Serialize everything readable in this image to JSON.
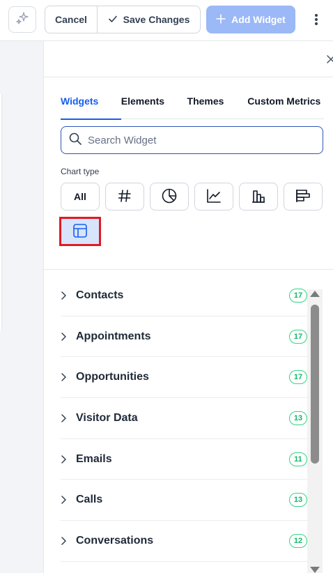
{
  "toolbar": {
    "ai_icon": "sparkle-icon",
    "cancel_label": "Cancel",
    "save_label": "Save Changes",
    "add_label": "Add Widget",
    "add_color": "#9bb8f7"
  },
  "panel": {
    "tabs": [
      {
        "label": "Widgets",
        "active": true
      },
      {
        "label": "Elements",
        "active": false
      },
      {
        "label": "Themes",
        "active": false
      },
      {
        "label": "Custom Metrics",
        "active": false
      }
    ],
    "search_placeholder": "Search Widget",
    "chart_type_label": "Chart type",
    "chart_types": [
      {
        "label": "All",
        "icon": ""
      },
      {
        "label": "",
        "icon": "hash-icon"
      },
      {
        "label": "",
        "icon": "pie-chart-icon"
      },
      {
        "label": "",
        "icon": "line-chart-icon"
      },
      {
        "label": "",
        "icon": "bar-chart-icon"
      },
      {
        "label": "",
        "icon": "horizontal-bar-chart-icon"
      },
      {
        "label": "",
        "icon": "table-icon",
        "selected": true
      }
    ],
    "categories": [
      {
        "label": "Contacts",
        "count": "17"
      },
      {
        "label": "Appointments",
        "count": "17"
      },
      {
        "label": "Opportunities",
        "count": "17"
      },
      {
        "label": "Visitor Data",
        "count": "13"
      },
      {
        "label": "Emails",
        "count": "11"
      },
      {
        "label": "Calls",
        "count": "13"
      },
      {
        "label": "Conversations",
        "count": "12"
      }
    ],
    "accent_color": "#155eef",
    "count_color": "#12b76a",
    "highlight_color": "#e01b24"
  }
}
